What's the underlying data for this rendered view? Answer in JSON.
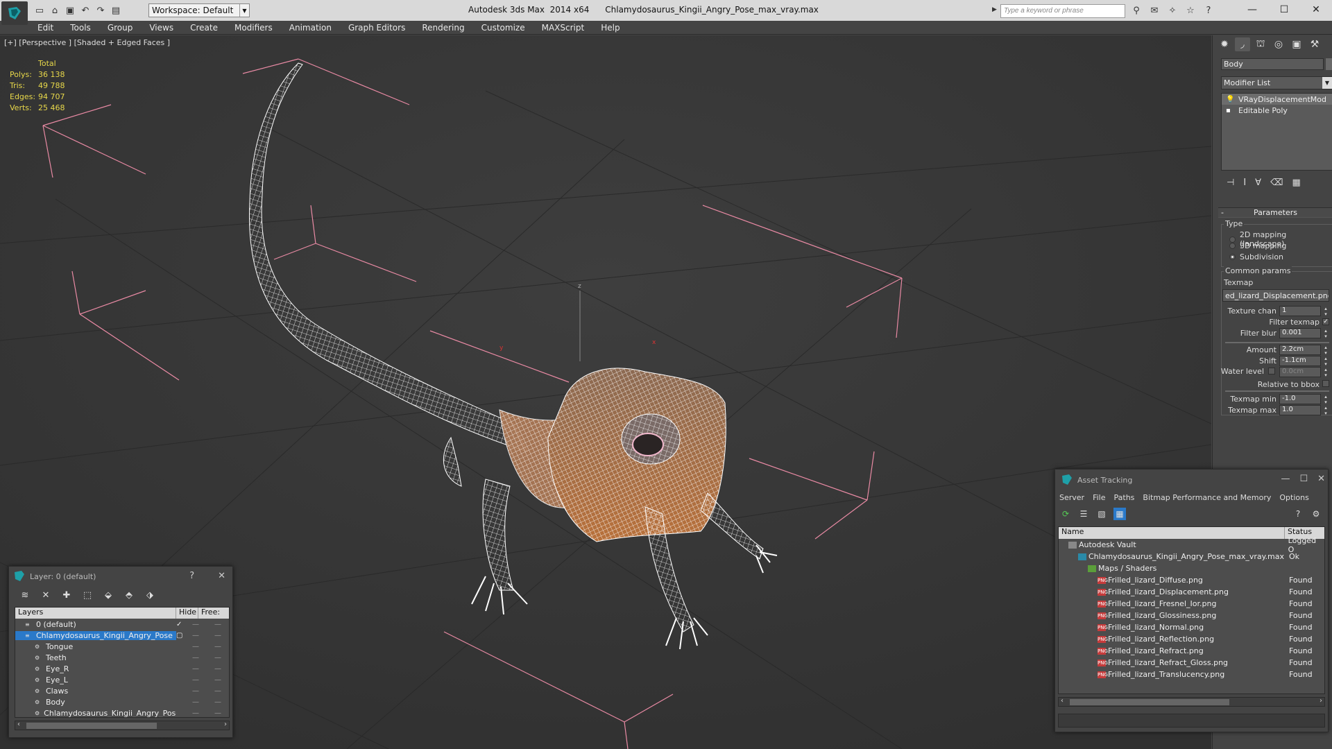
{
  "titlebar": {
    "title": "Autodesk 3ds Max  2014 x64      Chlamydosaurus_Kingii_Angry_Pose_max_vray.max",
    "workspace_label": "Workspace: Default",
    "search_placeholder": "Type a keyword or phrase",
    "qat_icons": [
      "new-file-icon",
      "open-file-icon",
      "save-icon",
      "undo-icon",
      "redo-icon",
      "project-folder-icon"
    ],
    "right_icons": [
      "binoculars-icon",
      "communication-center-icon",
      "favorites-icon",
      "star-icon",
      "help-icon"
    ]
  },
  "menu": [
    "Edit",
    "Tools",
    "Group",
    "Views",
    "Create",
    "Modifiers",
    "Animation",
    "Graph Editors",
    "Rendering",
    "Customize",
    "MAXScript",
    "Help"
  ],
  "viewport": {
    "label": "[+] [Perspective ] [Shaded + Edged Faces ]",
    "stats": {
      "header": "Total",
      "rows": [
        {
          "key": "Polys:",
          "value": "36 138"
        },
        {
          "key": "Tris:",
          "value": "49 788"
        },
        {
          "key": "Edges:",
          "value": "94 707"
        },
        {
          "key": "Verts:",
          "value": "25 468"
        }
      ]
    },
    "gizmo_labels": {
      "z": "z",
      "y": "y",
      "x": "x"
    }
  },
  "command_panel": {
    "object_name": "Body",
    "modifier_list": "Modifier List",
    "stack": [
      "VRayDisplacementMod",
      "Editable Poly"
    ],
    "rollout": "Parameters",
    "type_group": "Type",
    "type_options": [
      {
        "label": "2D mapping (landscape)",
        "selected": false
      },
      {
        "label": "3D mapping",
        "selected": false
      },
      {
        "label": "Subdivision",
        "selected": true
      }
    ],
    "common_group": "Common params",
    "texmap_label": "Texmap",
    "texmap_value": "ed_lizard_Displacement.png)",
    "texture_chan_label": "Texture chan",
    "texture_chan_value": "1",
    "filter_texmap_label": "Filter texmap",
    "filter_blur_label": "Filter blur",
    "filter_blur_value": "0.001",
    "amount_label": "Amount",
    "amount_value": "2.2cm",
    "shift_label": "Shift",
    "shift_value": "-1.1cm",
    "water_label": "Water level",
    "water_value": "0.0cm",
    "relative_label": "Relative to bbox",
    "texmap_min_label": "Texmap min",
    "texmap_min_value": "-1.0",
    "texmap_max_label": "Texmap max",
    "texmap_max_value": "1.0"
  },
  "asset_tracking": {
    "title": "Asset Tracking",
    "menu": [
      "Server",
      "File",
      "Paths",
      "Bitmap Performance and Memory",
      "Options"
    ],
    "col_name": "Name",
    "col_status": "Status",
    "rows": [
      {
        "name": "Autodesk Vault",
        "status": "Logged O",
        "indent": 1,
        "icon": "vault"
      },
      {
        "name": "Chlamydosaurus_Kingii_Angry_Pose_max_vray.max",
        "status": "Ok",
        "indent": 2,
        "icon": "max"
      },
      {
        "name": "Maps / Shaders",
        "status": "",
        "indent": 3,
        "icon": "fold"
      },
      {
        "name": "Frilled_lizard_Diffuse.png",
        "status": "Found",
        "indent": 4,
        "icon": "png"
      },
      {
        "name": "Frilled_lizard_Displacement.png",
        "status": "Found",
        "indent": 4,
        "icon": "png"
      },
      {
        "name": "Frilled_lizard_Fresnel_Ior.png",
        "status": "Found",
        "indent": 4,
        "icon": "png"
      },
      {
        "name": "Frilled_lizard_Glossiness.png",
        "status": "Found",
        "indent": 4,
        "icon": "png"
      },
      {
        "name": "Frilled_lizard_Normal.png",
        "status": "Found",
        "indent": 4,
        "icon": "png"
      },
      {
        "name": "Frilled_lizard_Reflection.png",
        "status": "Found",
        "indent": 4,
        "icon": "png"
      },
      {
        "name": "Frilled_lizard_Refract.png",
        "status": "Found",
        "indent": 4,
        "icon": "png"
      },
      {
        "name": "Frilled_lizard_Refract_Gloss.png",
        "status": "Found",
        "indent": 4,
        "icon": "png"
      },
      {
        "name": "Frilled_lizard_Translucency.png",
        "status": "Found",
        "indent": 4,
        "icon": "png"
      }
    ]
  },
  "layer_dialog": {
    "title": "Layer: 0 (default)",
    "help": "?",
    "col_layers": "Layers",
    "col_hide": "Hide",
    "col_freeze": "Free:",
    "rows": [
      {
        "name": "0 (default)",
        "indent": 1,
        "selected": false,
        "current": true
      },
      {
        "name": "Chlamydosaurus_Kingii_Angry_Pose",
        "indent": 1,
        "selected": true,
        "current": false
      },
      {
        "name": "Tongue",
        "indent": 2,
        "selected": false,
        "current": false
      },
      {
        "name": "Teeth",
        "indent": 2,
        "selected": false,
        "current": false
      },
      {
        "name": "Eye_R",
        "indent": 2,
        "selected": false,
        "current": false
      },
      {
        "name": "Eye_L",
        "indent": 2,
        "selected": false,
        "current": false
      },
      {
        "name": "Claws",
        "indent": 2,
        "selected": false,
        "current": false
      },
      {
        "name": "Body",
        "indent": 2,
        "selected": false,
        "current": false
      },
      {
        "name": "Chlamydosaurus_Kingii_Angry_Pose",
        "indent": 2,
        "selected": false,
        "current": false
      }
    ]
  }
}
